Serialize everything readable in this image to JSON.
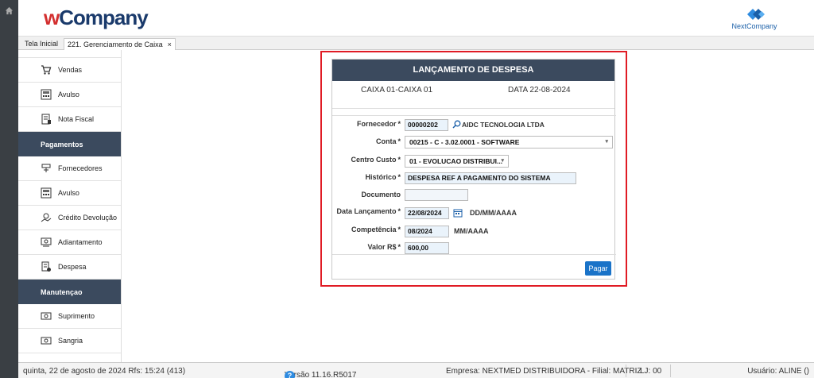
{
  "header": {
    "brand": "wCompany",
    "brand_w": "w",
    "brand_rest": "Company",
    "partner": "NextCompany"
  },
  "tabs": [
    {
      "label": "Tela Inicial"
    },
    {
      "label": "221. Gerenciamento de Caixa",
      "close": "×"
    }
  ],
  "sidebar": {
    "items": [
      {
        "label": "Vendas",
        "icon": "cart-icon"
      },
      {
        "label": "Avulso",
        "icon": "calculator-icon"
      },
      {
        "label": "Nota Fiscal",
        "icon": "invoice-icon"
      }
    ],
    "sections": [
      {
        "title": "Pagamentos",
        "items": [
          {
            "label": "Fornecedores",
            "icon": "supplier-icon"
          },
          {
            "label": "Avulso",
            "icon": "calculator-icon"
          },
          {
            "label": "Crédito Devolução",
            "icon": "refund-icon"
          },
          {
            "label": "Adiantamento",
            "icon": "advance-icon"
          },
          {
            "label": "Despesa",
            "icon": "expense-icon"
          }
        ]
      },
      {
        "title": "Manutençao",
        "items": [
          {
            "label": "Suprimento",
            "icon": "cash-in-icon"
          },
          {
            "label": "Sangria",
            "icon": "cash-out-icon"
          }
        ]
      }
    ]
  },
  "form": {
    "title": "LANÇAMENTO DE DESPESA",
    "caixa": "CAIXA  01-CAIXA 01",
    "data": "DATA  22-08-2024",
    "fornecedor_label": "Fornecedor",
    "fornecedor_code": "00000202",
    "fornecedor_name": "AIDC TECNOLOGIA LTDA",
    "conta_label": "Conta",
    "conta_value": "00215 - C - 3.02.0001 - SOFTWARE",
    "centro_label": "Centro Custo",
    "centro_value": "01 - EVOLUCAO DISTRIBUI...",
    "historico_label": "Histórico",
    "historico_value": "DESPESA REF A PAGAMENTO DO SISTEMA",
    "documento_label": "Documento",
    "documento_value": "",
    "data_lanc_label": "Data Lançamento",
    "data_lanc_value": "22/08/2024",
    "data_lanc_hint": "DD/MM/AAAA",
    "competencia_label": "Competência",
    "competencia_value": "08/2024",
    "competencia_hint": "MM/AAAA",
    "valor_label": "Valor R$",
    "valor_value": "600,00",
    "required_mark": "*",
    "submit": "Pagar"
  },
  "status": {
    "datetime": "quinta, 22 de agosto de 2024  Rfs: 15:24 (413)",
    "version": "Versão 11.16.R5017",
    "help": "?",
    "company": "Empresa: NEXTMED DISTRIBUIDORA - Filial: MATRIZ",
    "lj": "LJ: 00",
    "user": "Usuário: ALINE ()"
  },
  "colors": {
    "accent": "#1a73c8",
    "section_bg": "#3b4a5e",
    "highlight": "#e01b24"
  }
}
